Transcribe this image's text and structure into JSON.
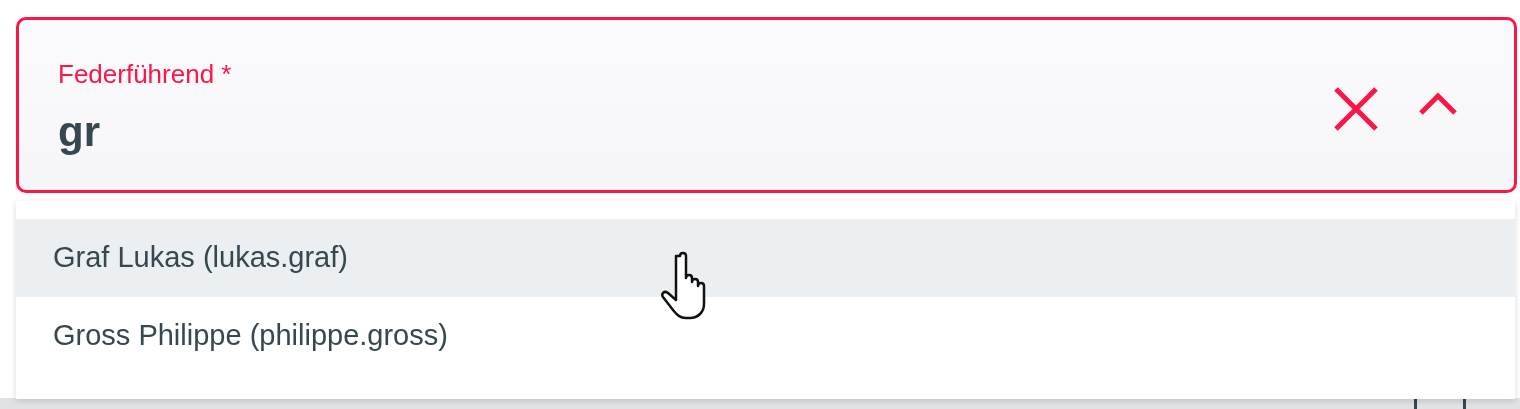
{
  "field": {
    "label": "Federführend *",
    "value": "gr",
    "invalid": true,
    "expanded": true
  },
  "options": [
    {
      "label": "Graf Lukas (lukas.graf)",
      "selected": true
    },
    {
      "label": "Gross Philippe (philippe.gross)",
      "selected": false
    }
  ]
}
